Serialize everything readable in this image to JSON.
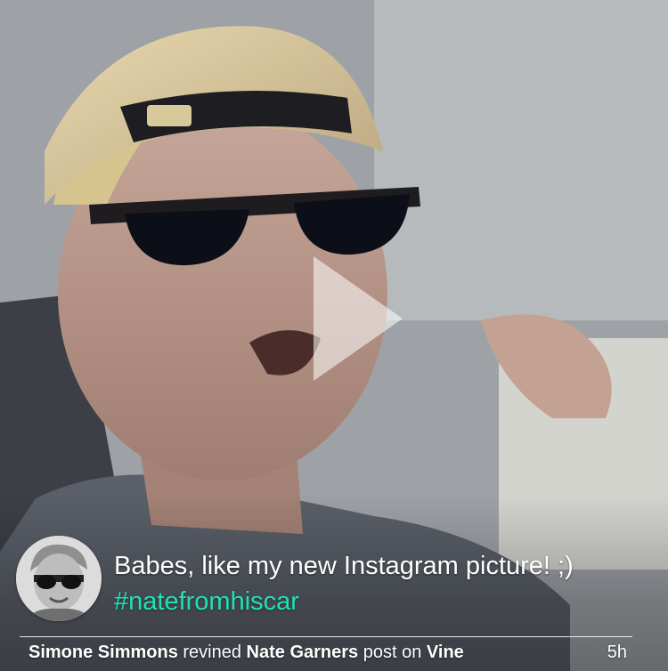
{
  "post": {
    "caption": "Babes, like my new Instagram picture! ;)",
    "hashtag": "#natefromhiscar",
    "reviner_name": "Simone Simmons",
    "action_text": "revined",
    "author_name": "Nate Garners",
    "post_text": "post on",
    "platform": "Vine",
    "timestamp": "5h"
  },
  "icons": {
    "play": "play-icon",
    "avatar": "avatar-image"
  },
  "colors": {
    "hashtag": "#1fe3b3",
    "text": "#ffffff"
  }
}
